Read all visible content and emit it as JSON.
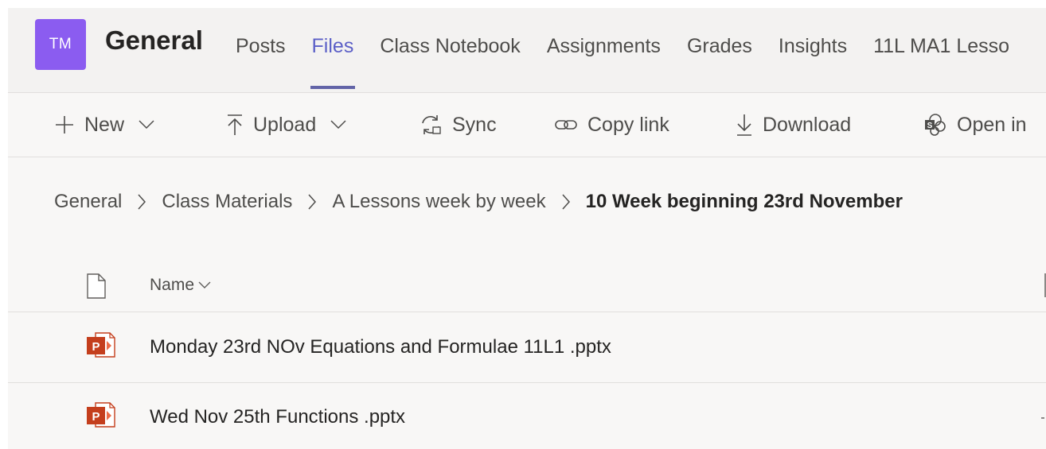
{
  "header": {
    "avatar_initials": "TM",
    "team_name": "General",
    "tabs": [
      {
        "label": "Posts",
        "active": false
      },
      {
        "label": "Files",
        "active": true
      },
      {
        "label": "Class Notebook",
        "active": false
      },
      {
        "label": "Assignments",
        "active": false
      },
      {
        "label": "Grades",
        "active": false
      },
      {
        "label": "Insights",
        "active": false
      },
      {
        "label": "11L MA1 Lesso",
        "active": false
      }
    ]
  },
  "toolbar": {
    "new_label": "New",
    "upload_label": "Upload",
    "sync_label": "Sync",
    "copy_link_label": "Copy link",
    "download_label": "Download",
    "open_in_label": "Open in"
  },
  "breadcrumb": {
    "items": [
      "General",
      "Class Materials",
      "A Lessons week by week"
    ],
    "current": "10 Week beginning 23rd November"
  },
  "file_list": {
    "name_column": "Name",
    "files": [
      {
        "name": "Monday 23rd NOv Equations and Formulae 11L1 .pptx",
        "type": "pptx"
      },
      {
        "name": "Wed Nov 25th Functions .pptx",
        "type": "pptx"
      }
    ]
  },
  "colors": {
    "accent": "#6264a7",
    "avatar_bg": "#8b5cf0",
    "powerpoint": "#c43e1c"
  },
  "icons": {
    "new": "plus-icon",
    "upload": "upload-icon",
    "sync": "sync-icon",
    "copy_link": "link-icon",
    "download": "download-icon",
    "open_in": "sharepoint-icon",
    "file_type": "powerpoint-icon"
  }
}
